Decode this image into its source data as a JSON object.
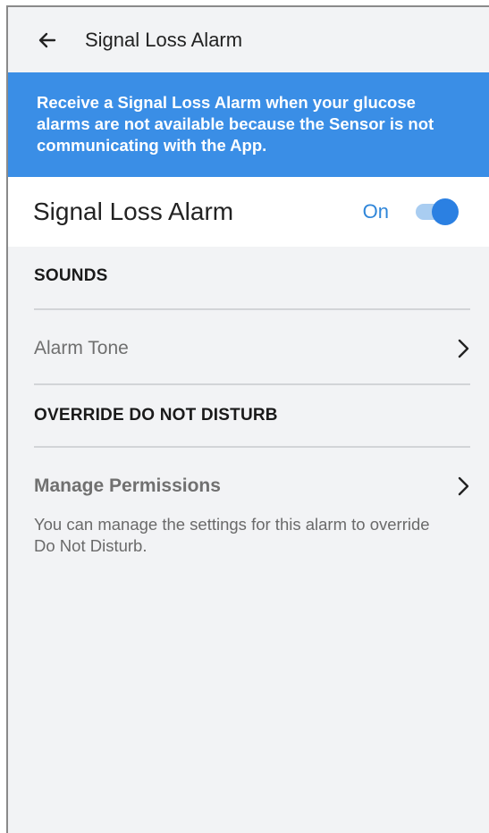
{
  "header": {
    "title": "Signal Loss Alarm",
    "back_icon": "arrow-left-icon"
  },
  "banner": {
    "text": "Receive a Signal Loss Alarm when your glucose alarms are not available because the Sensor is not communicating  with the App."
  },
  "alarm_toggle": {
    "label": "Signal Loss Alarm",
    "state_label": "On",
    "enabled": true
  },
  "sections": {
    "sounds": {
      "title": "SOUNDS",
      "alarm_tone_label": "Alarm Tone"
    },
    "override": {
      "title": "OVERRIDE DO NOT DISTURB",
      "manage_label": "Manage Permissions",
      "description": "You can manage the settings for this alarm to override Do Not Disturb."
    }
  },
  "colors": {
    "accent": "#3a8ee6",
    "switch_thumb": "#2b80e2",
    "switch_track": "#a9cdf1",
    "background": "#f2f3f5"
  }
}
